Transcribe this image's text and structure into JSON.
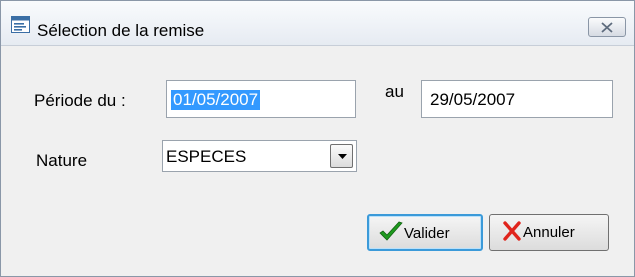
{
  "window": {
    "title": "Sélection de la remise",
    "icon": "form-window-icon",
    "close_icon": "close-icon"
  },
  "form": {
    "periode_label": "Période du :",
    "date_from": "01/05/2007",
    "au_label": "au",
    "date_to": "29/05/2007",
    "nature_label": "Nature",
    "nature_value": "ESPECES"
  },
  "buttons": {
    "valider_label": "Valider",
    "annuler_label": "Annuler",
    "valider_icon": "checkmark-icon",
    "annuler_icon": "x-cross-icon"
  },
  "colors": {
    "selection": "#3399ff",
    "focus_border": "#3b9ad9",
    "check_green": "#1e9a1e",
    "cross_red": "#e0241c"
  }
}
